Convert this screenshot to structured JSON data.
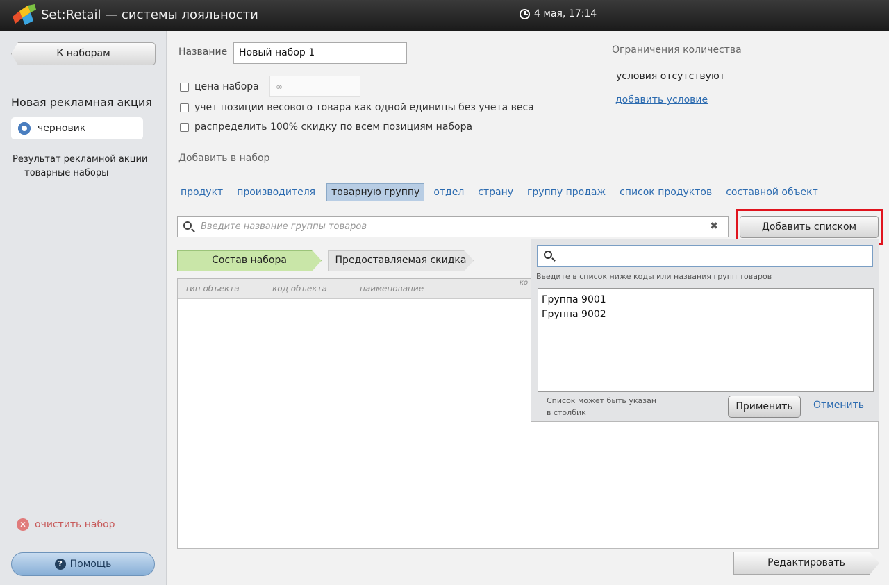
{
  "titlebar": {
    "app_title": "Set:Retail — системы лояльности",
    "datetime": "4 мая, 17:14",
    "logo_icon": "set-retail-logo-icon"
  },
  "sidebar": {
    "back_label": "К наборам",
    "promo_title": "Новая рекламная акция",
    "status": "черновик",
    "result_text": "Результат рекламной акции — товарные наборы",
    "clear_label": "очистить набор",
    "help_label": "Помощь"
  },
  "form": {
    "name_label": "Название",
    "name_value": "Новый набор 1",
    "price_label": "цена набора",
    "price_value": "∞",
    "weight_label": "учет позиции весового товара как одной единицы без учета веса",
    "discount_label": "распределить 100% скидку по всем позициям набора",
    "limits_title": "Ограничения количества",
    "limits_none": "условия отсутствуют",
    "add_condition": "добавить условие",
    "add_to_set": "Добавить в набор"
  },
  "types": [
    "продукт",
    "производителя",
    "товарную группу",
    "отдел",
    "страну",
    "группу продаж",
    "список продуктов",
    "составной объект"
  ],
  "selected_type_index": 2,
  "search": {
    "placeholder": "Введите название группы товаров",
    "add_list_label": "Добавить списком"
  },
  "tabs": {
    "composition": "Состав набора",
    "discount": "Предоставляемая скидка"
  },
  "table": {
    "headers": [
      "тип объекта",
      "код объекта",
      "наименование",
      "ко"
    ]
  },
  "edit_label": "Редактировать",
  "popup": {
    "hint": "Введите в список ниже коды или названия групп товаров",
    "items": [
      "Группа 9001",
      "Группа 9002"
    ],
    "note": "Список может быть указан в столбик",
    "apply_label": "Применить",
    "cancel_label": "Отменить"
  },
  "colors": {
    "highlight": "#e0141e",
    "link": "#2c6bb0",
    "tab_active": "#c9e6a8"
  }
}
